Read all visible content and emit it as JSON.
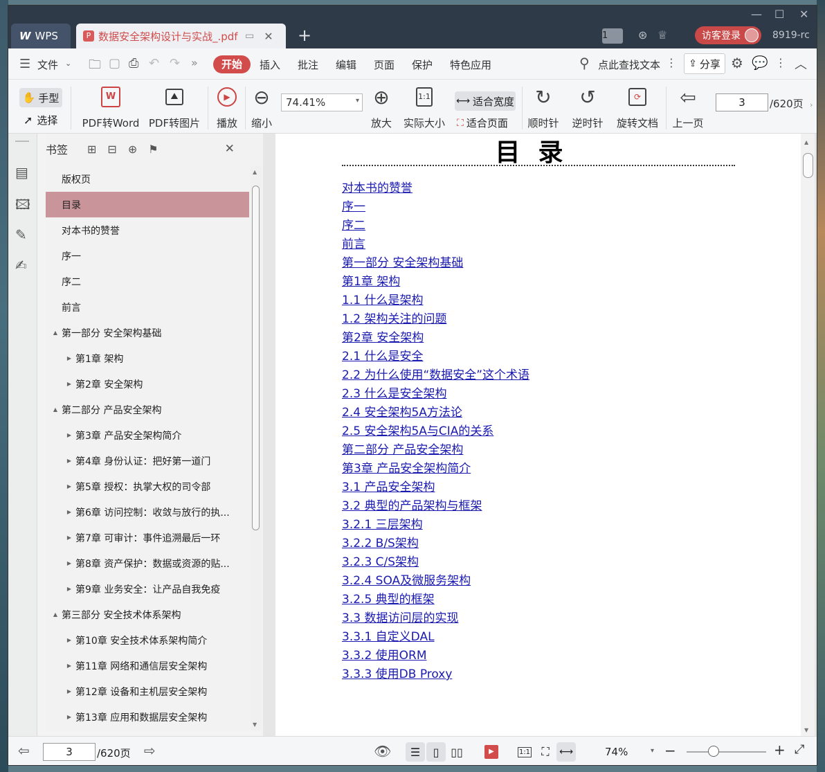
{
  "titlebar": {
    "app_tab": "WPS",
    "doc_tab": "数据安全架构设计与实战_.pdf",
    "page_badge": "1",
    "login": "访客登录",
    "user_id": "8919-rc"
  },
  "menu": {
    "file": "文件",
    "items": [
      "开始",
      "插入",
      "批注",
      "编辑",
      "页面",
      "保护",
      "特色应用"
    ],
    "search": "点此查找文本",
    "share": "分享"
  },
  "ribbon": {
    "hand": "手型",
    "select": "选择",
    "pdf_to_word": "PDF转Word",
    "pdf_to_image": "PDF转图片",
    "play": "播放",
    "zoom_out": "缩小",
    "zoom_value": "74.41%",
    "zoom_in": "放大",
    "actual_size": "实际大小",
    "fit_width": "适合宽度",
    "fit_page": "适合页面",
    "clockwise": "顺时针",
    "counterclockwise": "逆时针",
    "rotate_doc": "旋转文档",
    "prev_page": "上一页",
    "page_current": "3",
    "page_total": "/620页"
  },
  "bookmarks": {
    "title": "书签",
    "items": [
      {
        "label": "版权页",
        "level": 0,
        "toggle": ""
      },
      {
        "label": "目录",
        "level": 0,
        "toggle": "",
        "selected": true
      },
      {
        "label": "对本书的赞誉",
        "level": 0,
        "toggle": ""
      },
      {
        "label": "序一",
        "level": 0,
        "toggle": ""
      },
      {
        "label": "序二",
        "level": 0,
        "toggle": ""
      },
      {
        "label": "前言",
        "level": 0,
        "toggle": ""
      },
      {
        "label": "第一部分 安全架构基础",
        "level": 0,
        "toggle": "▲"
      },
      {
        "label": "第1章 架构",
        "level": 1,
        "toggle": "▶"
      },
      {
        "label": "第2章 安全架构",
        "level": 1,
        "toggle": "▶"
      },
      {
        "label": "第二部分 产品安全架构",
        "level": 0,
        "toggle": "▲"
      },
      {
        "label": "第3章 产品安全架构简介",
        "level": 1,
        "toggle": "▶"
      },
      {
        "label": "第4章 身份认证：把好第一道门",
        "level": 1,
        "toggle": "▶"
      },
      {
        "label": "第5章 授权：执掌大权的司令部",
        "level": 1,
        "toggle": "▶"
      },
      {
        "label": "第6章 访问控制：收敛与放行的执...",
        "level": 1,
        "toggle": "▶"
      },
      {
        "label": "第7章 可审计：事件追溯最后一环",
        "level": 1,
        "toggle": "▶"
      },
      {
        "label": "第8章 资产保护：数据或资源的贴...",
        "level": 1,
        "toggle": "▶"
      },
      {
        "label": "第9章 业务安全：让产品自我免疫",
        "level": 1,
        "toggle": "▶"
      },
      {
        "label": "第三部分 安全技术体系架构",
        "level": 0,
        "toggle": "▲"
      },
      {
        "label": "第10章 安全技术体系架构简介",
        "level": 1,
        "toggle": "▶"
      },
      {
        "label": "第11章 网络和通信层安全架构",
        "level": 1,
        "toggle": "▶"
      },
      {
        "label": "第12章 设备和主机层安全架构",
        "level": 1,
        "toggle": "▶"
      },
      {
        "label": "第13章 应用和数据层安全架构",
        "level": 1,
        "toggle": "▶"
      }
    ]
  },
  "document": {
    "title": "目录",
    "toc": [
      "对本书的赞誉",
      "序一",
      "序二",
      "前言",
      "第一部分 安全架构基础",
      "第1章 架构",
      "1.1 什么是架构",
      "1.2 架构关注的问题",
      "第2章 安全架构",
      "2.1 什么是安全",
      "2.2 为什么使用“数据安全”这个术语",
      "2.3 什么是安全架构",
      "2.4 安全架构5A方法论",
      "2.5 安全架构5A与CIA的关系",
      "第二部分 产品安全架构",
      "第3章 产品安全架构简介",
      "3.1 产品安全架构",
      "3.2 典型的产品架构与框架",
      "3.2.1 三层架构",
      "3.2.2 B/S架构",
      "3.2.3 C/S架构",
      "3.2.4 SOA及微服务架构",
      "3.2.5 典型的框架",
      "3.3 数据访问层的实现",
      "3.3.1 自定义DAL",
      "3.3.2 使用ORM",
      "3.3.3 使用DB Proxy"
    ]
  },
  "status": {
    "page_current": "3",
    "page_total": "/620页",
    "zoom": "74%"
  },
  "colors": {
    "accent": "#d34c4c",
    "titlebar": "#2f3a48",
    "link": "#1a1ab0",
    "selected_bookmark": "#c9959a"
  }
}
